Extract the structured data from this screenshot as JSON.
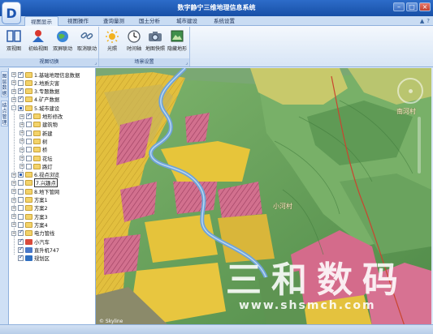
{
  "window": {
    "title": "数字静宁三维地理信息系统",
    "logo_letter": "D"
  },
  "tabs": [
    {
      "label": "视图显示",
      "active": true
    },
    {
      "label": "视图操作",
      "active": false
    },
    {
      "label": "查询量测",
      "active": false
    },
    {
      "label": "国土分析",
      "active": false
    },
    {
      "label": "城市建设",
      "active": false
    },
    {
      "label": "系统设置",
      "active": false
    }
  ],
  "ribbon": {
    "groups": [
      {
        "label": "视图切换",
        "buttons": [
          {
            "label": "双视图",
            "icon": "dual-view-icon"
          },
          {
            "label": "初始视图",
            "icon": "initial-view-icon"
          },
          {
            "label": "双屏联动",
            "icon": "dual-screen-link-icon"
          },
          {
            "label": "取消联动",
            "icon": "cancel-link-icon"
          }
        ]
      },
      {
        "label": "场景设置",
        "buttons": [
          {
            "label": "光照",
            "icon": "sun-icon"
          },
          {
            "label": "时间轴",
            "icon": "clock-icon"
          },
          {
            "label": "地图快照",
            "icon": "camera-icon"
          },
          {
            "label": "隐藏地形",
            "icon": "hide-terrain-icon"
          }
        ]
      }
    ]
  },
  "side_tabs": [
    "图层数据",
    "结点管理"
  ],
  "tree": [
    {
      "label": "1.基础地理信息数据",
      "level": 0,
      "expander": "+",
      "check": "checked",
      "icon": "folder"
    },
    {
      "label": "2.地质灾害",
      "level": 0,
      "expander": "+",
      "check": "none",
      "icon": "folder"
    },
    {
      "label": "3.专题数据",
      "level": 0,
      "expander": "+",
      "check": "checked",
      "icon": "folder"
    },
    {
      "label": "4.矿产数据",
      "level": 0,
      "expander": "+",
      "check": "checked",
      "icon": "folder"
    },
    {
      "label": "5.城市建设",
      "level": 0,
      "expander": "-",
      "check": "partial",
      "icon": "folder"
    },
    {
      "label": "地形修改",
      "level": 1,
      "expander": "+",
      "check": "checked",
      "icon": "folder"
    },
    {
      "label": "建筑物",
      "level": 1,
      "expander": "+",
      "check": "none",
      "icon": "folder"
    },
    {
      "label": "新建",
      "level": 1,
      "expander": "+",
      "check": "none",
      "icon": "folder"
    },
    {
      "label": "树",
      "level": 1,
      "expander": "+",
      "check": "none",
      "icon": "folder"
    },
    {
      "label": "桥",
      "level": 1,
      "expander": "+",
      "check": "none",
      "icon": "folder"
    },
    {
      "label": "花坛",
      "level": 1,
      "expander": "+",
      "check": "none",
      "icon": "folder"
    },
    {
      "label": "路灯",
      "level": 1,
      "expander": "+",
      "check": "none",
      "icon": "folder"
    },
    {
      "label": "6.视点浏览",
      "level": 0,
      "expander": "+",
      "check": "partial",
      "icon": "folder"
    },
    {
      "label": "7.兴趣点",
      "level": 0,
      "expander": "+",
      "check": "none",
      "icon": "folder",
      "boxed": true
    },
    {
      "label": "8.地下管网",
      "level": 0,
      "expander": "+",
      "check": "none",
      "icon": "folder"
    },
    {
      "label": "方案1",
      "level": 0,
      "expander": "+",
      "check": "none",
      "icon": "folder"
    },
    {
      "label": "方案2",
      "level": 0,
      "expander": "+",
      "check": "none",
      "icon": "folder"
    },
    {
      "label": "方案3",
      "level": 0,
      "expander": "+",
      "check": "none",
      "icon": "folder"
    },
    {
      "label": "方案4",
      "level": 0,
      "expander": "+",
      "check": "none",
      "icon": "folder"
    },
    {
      "label": "电力管线",
      "level": 0,
      "expander": "+",
      "check": "checked",
      "icon": "folder"
    },
    {
      "label": "小汽车",
      "level": 0,
      "expander": "",
      "check": "checked",
      "icon": "car"
    },
    {
      "label": "直升机747",
      "level": 0,
      "expander": "",
      "check": "checked",
      "icon": "plane"
    },
    {
      "label": "规划区",
      "level": 0,
      "expander": "",
      "check": "checked",
      "icon": "shield"
    }
  ],
  "map": {
    "place_labels": [
      "南河村",
      "小河村"
    ],
    "watermark_main": "三和数码",
    "watermark_url": "www.shsmch.com",
    "engine_logo": "© Skyline"
  },
  "colors": {
    "accent": "#1f5fbf",
    "planning_pink": "#d86a8c",
    "farmland_yellow": "#e8c43c",
    "terrain_green": "#6ea35e"
  }
}
